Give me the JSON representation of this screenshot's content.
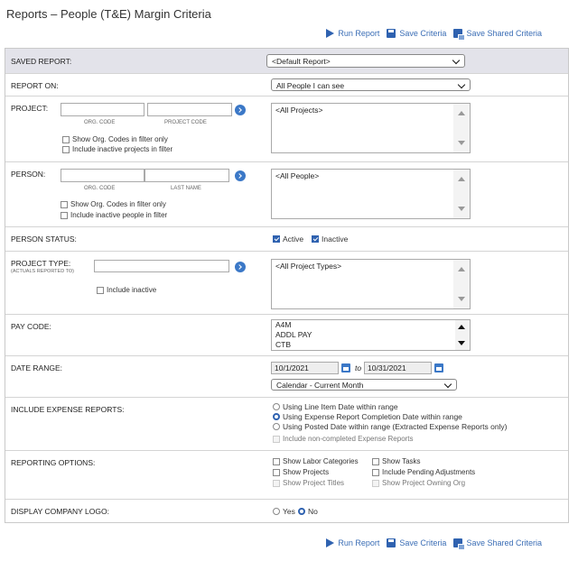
{
  "page": {
    "title": "Reports – People (T&E) Margin Criteria"
  },
  "toolbar": {
    "run_report": "Run Report",
    "save_criteria": "Save Criteria",
    "save_shared_criteria": "Save Shared Criteria"
  },
  "saved_report": {
    "label": "SAVED REPORT:",
    "value": "<Default Report>"
  },
  "report_on": {
    "label": "REPORT ON:",
    "value": "All People I can see"
  },
  "project": {
    "label": "PROJECT:",
    "org_code_sub": "ORG. CODE",
    "project_code_sub": "PROJECT CODE",
    "show_org_codes": "Show Org. Codes in filter only",
    "include_inactive": "Include inactive projects in filter",
    "list_item": "<All Projects>"
  },
  "person": {
    "label": "PERSON:",
    "org_code_sub": "ORG. CODE",
    "last_name_sub": "LAST NAME",
    "show_org_codes": "Show Org. Codes in filter only",
    "include_inactive": "Include inactive people in filter",
    "list_item": "<All People>"
  },
  "person_status": {
    "label": "PERSON STATUS:",
    "active": "Active",
    "inactive": "Inactive"
  },
  "project_type": {
    "label": "PROJECT TYPE:",
    "sub": "(ACTUALS REPORTED TO)",
    "include_inactive": "Include inactive",
    "list_item": "<All Project Types>"
  },
  "pay_code": {
    "label": "PAY CODE:",
    "items": [
      "A4M",
      "ADDL PAY",
      "CTB"
    ]
  },
  "date_range": {
    "label": "DATE RANGE:",
    "from": "10/1/2021",
    "to_word": "to",
    "to": "10/31/2021",
    "period": "Calendar - Current Month"
  },
  "expense_reports": {
    "label": "INCLUDE EXPENSE REPORTS:",
    "opt_line_item": "Using Line Item Date within range",
    "opt_completion": "Using Expense Report Completion Date within range",
    "opt_posted": "Using Posted Date within range (Extracted Expense Reports only)",
    "non_completed": "Include non-completed Expense Reports"
  },
  "reporting_options": {
    "label": "REPORTING OPTIONS:",
    "labor_categories": "Show Labor Categories",
    "tasks": "Show Tasks",
    "projects": "Show Projects",
    "pending_adjustments": "Include Pending Adjustments",
    "project_titles": "Show Project Titles",
    "project_owning_org": "Show Project Owning Org"
  },
  "company_logo": {
    "label": "DISPLAY COMPANY LOGO:",
    "yes": "Yes",
    "no": "No"
  },
  "colors": {
    "accent": "#2f62b0",
    "link": "#3a6db5",
    "header_bg": "#e3e3ea"
  }
}
